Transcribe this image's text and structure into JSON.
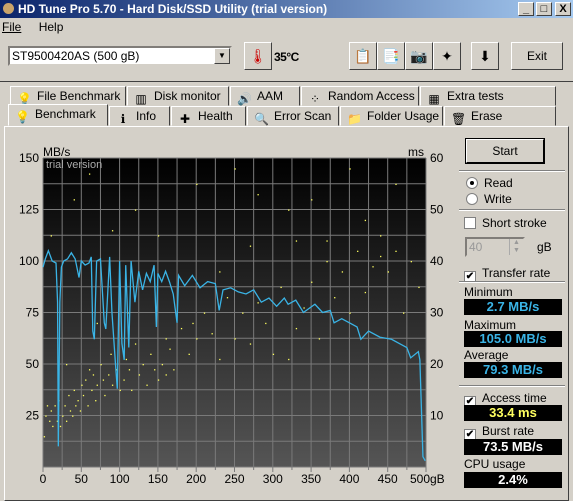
{
  "window": {
    "title": "HD Tune Pro 5.70 - Hard Disk/SSD Utility (trial version)",
    "minimize": "_",
    "maximize": "□",
    "close": "X"
  },
  "menu": [
    "File",
    "Help"
  ],
  "toolbar": {
    "drive": "ST9500420AS (500 gB)",
    "temperature": "35°C",
    "exit_label": "Exit",
    "buttons": [
      {
        "icon": "copy-info-icon",
        "glyph": "📋"
      },
      {
        "icon": "copy-all-icon",
        "glyph": "📑"
      },
      {
        "icon": "screenshot-camera-icon",
        "glyph": "📷"
      },
      {
        "icon": "options-icon",
        "glyph": "✦"
      },
      {
        "icon": "save-down-arrow-icon",
        "glyph": "⬇"
      }
    ]
  },
  "tabs_top": [
    {
      "label": "File Benchmark",
      "glyph": "💡"
    },
    {
      "label": "Disk monitor",
      "glyph": "▥"
    },
    {
      "label": "AAM",
      "glyph": "🔊"
    },
    {
      "label": "Random Access",
      "glyph": "⁘"
    },
    {
      "label": "Extra tests",
      "glyph": "▦"
    }
  ],
  "tabs_bottom": [
    {
      "label": "Benchmark",
      "glyph": "💡",
      "active": true
    },
    {
      "label": "Info",
      "glyph": "ℹ"
    },
    {
      "label": "Health",
      "glyph": "✚"
    },
    {
      "label": "Error Scan",
      "glyph": "🔍"
    },
    {
      "label": "Folder Usage",
      "glyph": "📁"
    },
    {
      "label": "Erase",
      "glyph": "🗑"
    }
  ],
  "side": {
    "start": "Start",
    "read": "Read",
    "write": "Write",
    "read_selected": true,
    "short_stroke": "Short stroke",
    "short_stroke_checked": false,
    "stroke_value": "40",
    "stroke_unit": "gB",
    "transfer_rate": "Transfer rate",
    "transfer_rate_checked": true,
    "minimum_label": "Minimum",
    "minimum": "2.7 MB/s",
    "maximum_label": "Maximum",
    "maximum": "105.0 MB/s",
    "average_label": "Average",
    "average": "79.3 MB/s",
    "access_time": "Access time",
    "access_time_checked": true,
    "access_value": "33.4 ms",
    "burst_rate": "Burst rate",
    "burst_rate_checked": true,
    "burst_value": "73.5 MB/s",
    "cpu_label": "CPU usage",
    "cpu_value": "2.4%"
  },
  "colors": {
    "transfer": "#3ab4e6",
    "access": "#ffff60",
    "min_max_avg_text": "#3ab4e6",
    "access_text": "#ffff60",
    "white_text": "#ffffff"
  },
  "chart_data": {
    "type": "line",
    "watermark": "trial version",
    "ylabel_left": "MB/s",
    "ylabel_right": "ms",
    "xunit": "gB",
    "xlim": [
      0,
      500
    ],
    "ylim_left": [
      0,
      150
    ],
    "ylim_right": [
      0,
      60
    ],
    "grid": true,
    "x_ticks": [
      "0",
      "50",
      "100",
      "150",
      "200",
      "250",
      "300",
      "350",
      "400",
      "450",
      "500"
    ],
    "y_ticks_left": [
      "25",
      "50",
      "75",
      "100",
      "125",
      "150"
    ],
    "y_ticks_right": [
      "10",
      "20",
      "30",
      "40",
      "50",
      "60"
    ],
    "series": [
      {
        "kind": "line",
        "axis": "left",
        "points": [
          [
            0,
            97
          ],
          [
            3,
            101
          ],
          [
            7,
            105
          ],
          [
            12,
            100
          ],
          [
            17,
            99
          ],
          [
            19,
            80
          ],
          [
            20,
            10
          ],
          [
            22,
            80
          ],
          [
            24,
            97
          ],
          [
            27,
            100
          ],
          [
            32,
            101
          ],
          [
            37,
            104
          ],
          [
            42,
            101
          ],
          [
            47,
            92
          ],
          [
            50,
            100
          ],
          [
            55,
            98
          ],
          [
            60,
            99
          ],
          [
            63,
            102
          ],
          [
            65,
            66
          ],
          [
            67,
            62
          ],
          [
            70,
            100
          ],
          [
            75,
            101
          ],
          [
            80,
            70
          ],
          [
            82,
            67
          ],
          [
            87,
            102
          ],
          [
            90,
            75
          ],
          [
            95,
            48
          ],
          [
            97,
            38
          ],
          [
            100,
            100
          ],
          [
            103,
            60
          ],
          [
            106,
            52
          ],
          [
            108,
            98
          ],
          [
            112,
            58
          ],
          [
            115,
            100
          ],
          [
            120,
            80
          ],
          [
            125,
            95
          ],
          [
            130,
            86
          ],
          [
            135,
            94
          ],
          [
            140,
            90
          ],
          [
            145,
            98
          ],
          [
            148,
            68
          ],
          [
            150,
            94
          ],
          [
            155,
            90
          ],
          [
            160,
            95
          ],
          [
            165,
            90
          ],
          [
            170,
            84
          ],
          [
            175,
            70
          ],
          [
            177,
            93
          ],
          [
            185,
            88
          ],
          [
            195,
            93
          ],
          [
            205,
            87
          ],
          [
            215,
            90
          ],
          [
            225,
            89
          ],
          [
            230,
            76
          ],
          [
            235,
            86
          ],
          [
            245,
            87
          ],
          [
            255,
            85
          ],
          [
            265,
            84
          ],
          [
            275,
            86
          ],
          [
            285,
            80
          ],
          [
            295,
            82
          ],
          [
            305,
            78
          ],
          [
            315,
            82
          ],
          [
            320,
            79
          ],
          [
            330,
            81
          ],
          [
            340,
            75
          ],
          [
            355,
            79
          ],
          [
            365,
            75
          ],
          [
            375,
            76
          ],
          [
            380,
            70
          ],
          [
            390,
            72
          ],
          [
            400,
            70
          ],
          [
            410,
            68
          ],
          [
            415,
            62
          ],
          [
            425,
            66
          ],
          [
            440,
            63
          ],
          [
            455,
            62
          ],
          [
            465,
            60
          ],
          [
            475,
            58
          ],
          [
            480,
            53
          ],
          [
            490,
            56
          ],
          [
            492,
            52
          ],
          [
            496,
            5
          ],
          [
            499,
            3
          ]
        ]
      },
      {
        "kind": "scatter",
        "axis": "right",
        "points": [
          [
            1,
            6
          ],
          [
            3,
            10
          ],
          [
            5,
            12
          ],
          [
            8,
            9
          ],
          [
            10,
            11
          ],
          [
            12,
            8
          ],
          [
            15,
            12
          ],
          [
            18,
            9
          ],
          [
            20,
            13
          ],
          [
            22,
            8
          ],
          [
            25,
            10
          ],
          [
            28,
            12
          ],
          [
            30,
            9
          ],
          [
            33,
            14
          ],
          [
            35,
            11
          ],
          [
            38,
            10
          ],
          [
            40,
            15
          ],
          [
            42,
            12
          ],
          [
            45,
            13
          ],
          [
            48,
            11
          ],
          [
            50,
            16
          ],
          [
            52,
            14
          ],
          [
            55,
            17
          ],
          [
            58,
            12
          ],
          [
            60,
            19
          ],
          [
            63,
            15
          ],
          [
            65,
            18
          ],
          [
            68,
            13
          ],
          [
            70,
            16
          ],
          [
            75,
            20
          ],
          [
            78,
            17
          ],
          [
            80,
            14
          ],
          [
            85,
            18
          ],
          [
            88,
            22
          ],
          [
            90,
            16
          ],
          [
            95,
            19
          ],
          [
            100,
            15
          ],
          [
            105,
            17
          ],
          [
            108,
            21
          ],
          [
            112,
            19
          ],
          [
            115,
            15
          ],
          [
            120,
            24
          ],
          [
            125,
            18
          ],
          [
            130,
            20
          ],
          [
            135,
            16
          ],
          [
            140,
            22
          ],
          [
            145,
            19
          ],
          [
            150,
            17
          ],
          [
            155,
            20
          ],
          [
            160,
            18
          ],
          [
            165,
            23
          ],
          [
            170,
            19
          ],
          [
            180,
            27
          ],
          [
            190,
            22
          ],
          [
            195,
            28
          ],
          [
            200,
            25
          ],
          [
            210,
            30
          ],
          [
            220,
            26
          ],
          [
            230,
            21
          ],
          [
            240,
            33
          ],
          [
            250,
            25
          ],
          [
            260,
            30
          ],
          [
            270,
            24
          ],
          [
            280,
            32
          ],
          [
            290,
            28
          ],
          [
            300,
            22
          ],
          [
            310,
            35
          ],
          [
            320,
            21
          ],
          [
            330,
            27
          ],
          [
            340,
            31
          ],
          [
            350,
            36
          ],
          [
            360,
            25
          ],
          [
            370,
            40
          ],
          [
            380,
            33
          ],
          [
            390,
            38
          ],
          [
            400,
            30
          ],
          [
            410,
            42
          ],
          [
            420,
            34
          ],
          [
            430,
            39
          ],
          [
            440,
            41
          ],
          [
            450,
            38
          ],
          [
            460,
            42
          ],
          [
            470,
            30
          ],
          [
            490,
            35
          ],
          [
            10,
            45
          ],
          [
            40,
            52
          ],
          [
            60,
            57
          ],
          [
            90,
            46
          ],
          [
            120,
            50
          ],
          [
            150,
            45
          ],
          [
            200,
            55
          ],
          [
            250,
            58
          ],
          [
            280,
            53
          ],
          [
            320,
            50
          ],
          [
            350,
            52
          ],
          [
            400,
            58
          ],
          [
            420,
            48
          ],
          [
            460,
            55
          ],
          [
            480,
            40
          ],
          [
            30,
            20
          ],
          [
            70,
            28
          ],
          [
            110,
            30
          ],
          [
            160,
            25
          ],
          [
            230,
            38
          ],
          [
            270,
            43
          ],
          [
            330,
            44
          ],
          [
            370,
            44
          ],
          [
            440,
            45
          ]
        ]
      }
    ]
  }
}
